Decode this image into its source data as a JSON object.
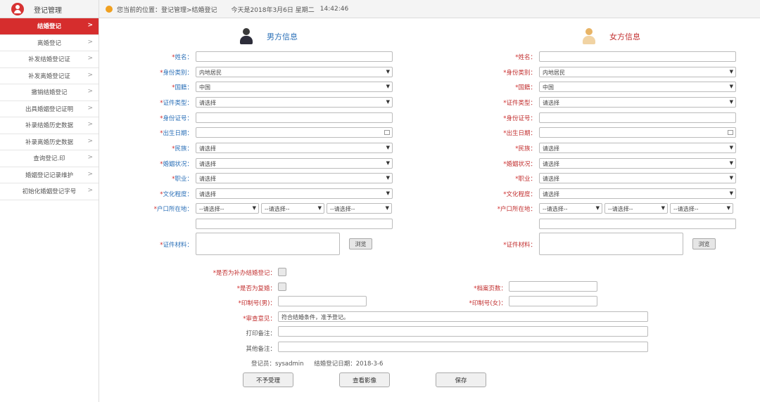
{
  "header": {
    "title": "登记管理",
    "breadcrumb": "您当前的位置：登记管理>结婚登记",
    "date": "今天是2018年3月6日 星期二",
    "time": "14:42:46"
  },
  "sidebar": {
    "items": [
      {
        "label": "结婚登记"
      },
      {
        "label": "离婚登记"
      },
      {
        "label": "补发结婚登记证"
      },
      {
        "label": "补发离婚登记证"
      },
      {
        "label": "撤销结婚登记"
      },
      {
        "label": "出具婚姻登记证明"
      },
      {
        "label": "补录结婚历史数据"
      },
      {
        "label": "补录离婚历史数据"
      },
      {
        "label": "查询登记.印"
      },
      {
        "label": "婚姻登记记录维护"
      },
      {
        "label": "初始化婚姻登记字号"
      }
    ]
  },
  "male": {
    "title": "男方信息",
    "name_label": "姓名：",
    "name_value": "",
    "idtype_label": "身份类别：",
    "idtype_value": "内地居民",
    "nationality_label": "国籍：",
    "nationality_value": "中国",
    "certtype_label": "证件类型：",
    "certtype_value": "请选择",
    "idno_label": "身份证号：",
    "idno_value": "",
    "birth_label": "出生日期：",
    "birth_value": "",
    "ethnic_label": "民族：",
    "ethnic_value": "请选择",
    "marital_label": "婚姻状况：",
    "marital_value": "请选择",
    "job_label": "职业：",
    "job_value": "请选择",
    "edu_label": "文化程度：",
    "edu_value": "请选择",
    "hukou_label": "户口所在地：",
    "hukou1": "--请选择--",
    "hukou2": "--请选择--",
    "hukou3": "--请选择--",
    "hukou_detail": "",
    "doc_label": "证件材料：",
    "browse_label": "浏览"
  },
  "female": {
    "title": "女方信息",
    "name_label": "姓名：",
    "name_value": "",
    "idtype_label": "身份类别：",
    "idtype_value": "内地居民",
    "nationality_label": "国籍：",
    "nationality_value": "中国",
    "certtype_label": "证件类型：",
    "certtype_value": "请选择",
    "idno_label": "身份证号：",
    "idno_value": "",
    "birth_label": "出生日期：",
    "birth_value": "",
    "ethnic_label": "民族：",
    "ethnic_value": "请选择",
    "marital_label": "婚姻状况：",
    "marital_value": "请选择",
    "job_label": "职业：",
    "job_value": "请选择",
    "edu_label": "文化程度：",
    "edu_value": "请选择",
    "hukou_label": "户口所在地：",
    "hukou1": "--请选择--",
    "hukou2": "--请选择--",
    "hukou3": "--请选择--",
    "hukou_detail": "",
    "doc_label": "证件材料：",
    "browse_label": "浏览"
  },
  "bottom": {
    "proxy_label": "是否为补办结婚登记：",
    "remarry_label": "是否为复婚：",
    "archive_label": "档案页数：",
    "print_m_label": "印制号(男)：",
    "print_f_label": "印制号(女)：",
    "opinion_label": "审查意见：",
    "opinion_value": "符合结婚条件，准予登记。",
    "print_note_label": "打印备注：",
    "other_note_label": "其他备注：",
    "registrar_label": "登记员：",
    "registrar_value": "sysadmin",
    "regdate_label": "结婚登记日期：",
    "regdate_value": "2018-3-6",
    "btn1": "不予受理",
    "btn2": "查看影像",
    "btn3": "保存"
  }
}
